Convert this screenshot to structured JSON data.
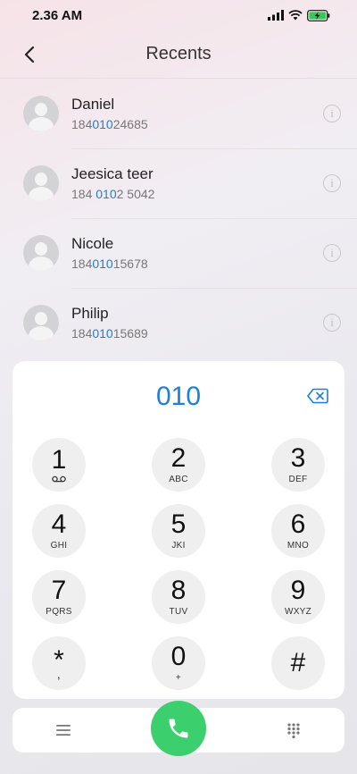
{
  "status_bar": {
    "time": "2.36 AM"
  },
  "header": {
    "title": "Recents"
  },
  "recents": [
    {
      "name": "Daniel",
      "number_pre": "184",
      "number_match": "010",
      "number_post": "24685"
    },
    {
      "name": "Jeesica teer",
      "number_pre": "184 ",
      "number_match": "010",
      "number_post": "2 5042"
    },
    {
      "name": "Nicole",
      "number_pre": "184",
      "number_match": "010",
      "number_post": "15678"
    },
    {
      "name": "Philip",
      "number_pre": "184",
      "number_match": "010",
      "number_post": "15689"
    }
  ],
  "dialer": {
    "input": "010",
    "keys": [
      {
        "digit": "1",
        "letters": ""
      },
      {
        "digit": "2",
        "letters": "ABC"
      },
      {
        "digit": "3",
        "letters": "DEF"
      },
      {
        "digit": "4",
        "letters": "GHI"
      },
      {
        "digit": "5",
        "letters": "JKI"
      },
      {
        "digit": "6",
        "letters": "MNO"
      },
      {
        "digit": "7",
        "letters": "PQRS"
      },
      {
        "digit": "8",
        "letters": "TUV"
      },
      {
        "digit": "9",
        "letters": "WXYZ"
      },
      {
        "digit": "*",
        "letters": ","
      },
      {
        "digit": "0",
        "letters": "+"
      },
      {
        "digit": "#",
        "letters": ""
      }
    ]
  },
  "icons": {
    "back": "chevron-left-icon",
    "info": "info-icon",
    "backspace": "backspace-icon",
    "voicemail": "voicemail-icon",
    "menu": "menu-icon",
    "call": "phone-icon",
    "keypad": "keypad-icon"
  },
  "colors": {
    "accent": "#1e7fd8",
    "call_button": "#3ccf6e",
    "key_background": "#efefef"
  }
}
